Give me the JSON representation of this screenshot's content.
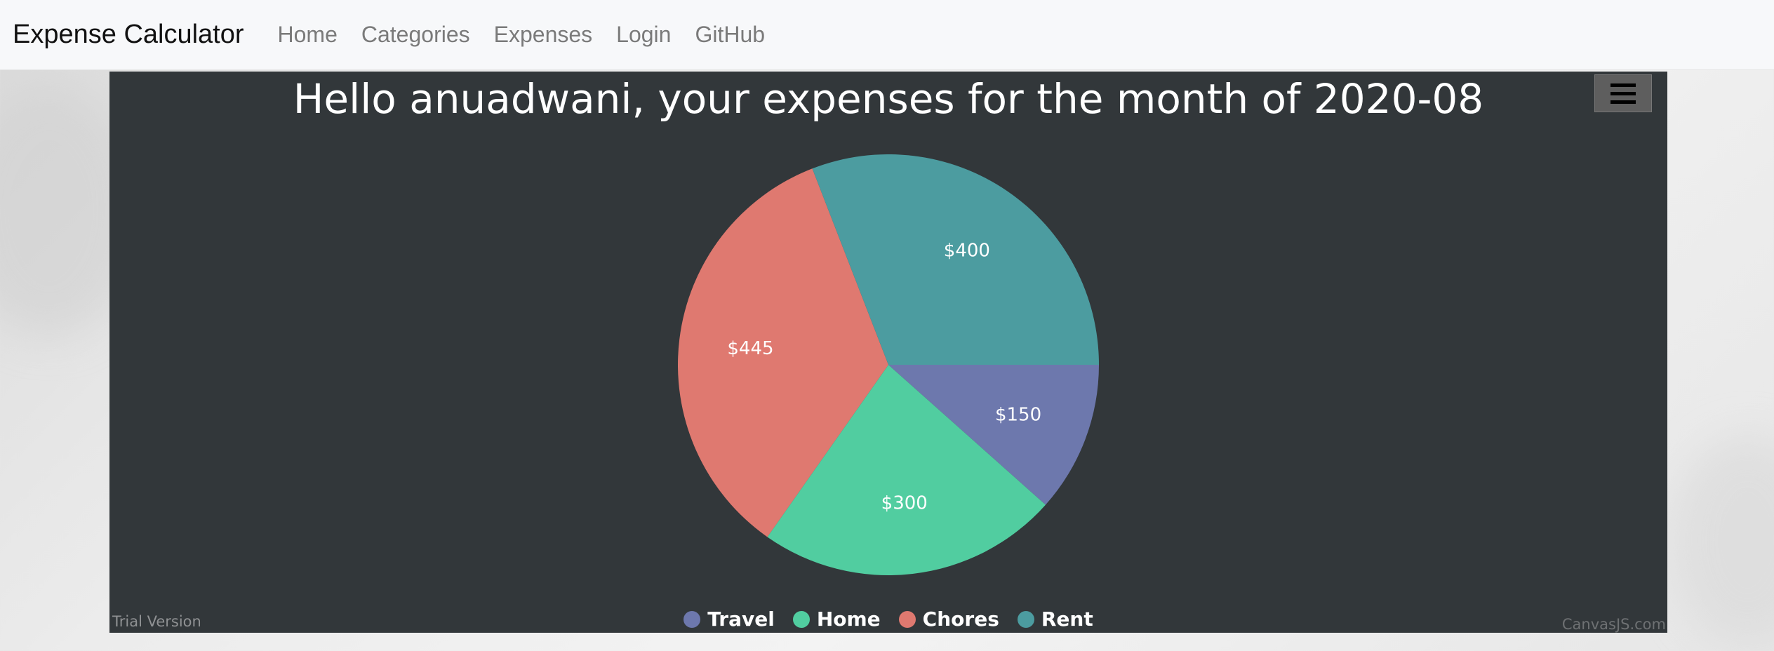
{
  "navbar": {
    "brand": "Expense Calculator",
    "links": [
      "Home",
      "Categories",
      "Expenses",
      "Login",
      "GitHub"
    ]
  },
  "chart_panel": {
    "menu_icon": "hamburger-menu-icon",
    "trial_text": "Trial Version",
    "credit_text": "CanvasJS.com",
    "background_color": "#32373a"
  },
  "chart_data": {
    "type": "pie",
    "title": "Hello anuadwani, your expenses for the month of 2020-08",
    "categories": [
      "Travel",
      "Home",
      "Chores",
      "Rent"
    ],
    "values": [
      150,
      300,
      445,
      400
    ],
    "labels": [
      "$150",
      "$300",
      "$445",
      "$400"
    ],
    "colors": [
      "#6d78ad",
      "#51cda0",
      "#df7970",
      "#4c9ca0"
    ],
    "legend_position": "bottom-center"
  }
}
